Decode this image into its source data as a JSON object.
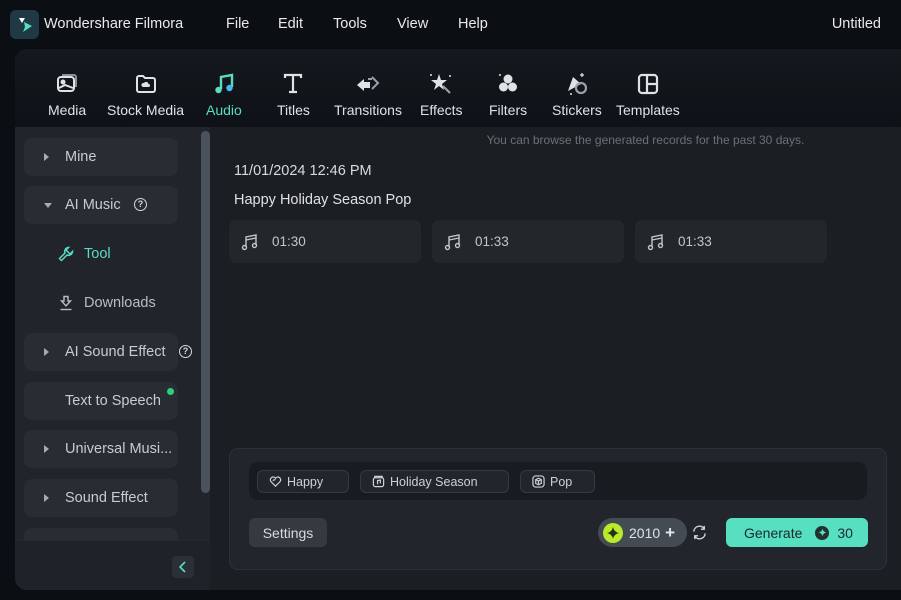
{
  "app": {
    "name": "Wondershare Filmora",
    "document_title": "Untitled",
    "menu": [
      "File",
      "Edit",
      "Tools",
      "View",
      "Help"
    ]
  },
  "toolbar": {
    "tabs": [
      {
        "label": "Media",
        "icon": "media-icon",
        "active": false
      },
      {
        "label": "Stock Media",
        "icon": "stock-media-icon",
        "active": false
      },
      {
        "label": "Audio",
        "icon": "music-note-icon",
        "active": true
      },
      {
        "label": "Titles",
        "icon": "text-t-icon",
        "active": false
      },
      {
        "label": "Transitions",
        "icon": "transitions-icon",
        "active": false
      },
      {
        "label": "Effects",
        "icon": "magic-wand-icon",
        "active": false
      },
      {
        "label": "Filters",
        "icon": "filters-icon",
        "active": false
      },
      {
        "label": "Stickers",
        "icon": "stickers-icon",
        "active": false
      },
      {
        "label": "Templates",
        "icon": "templates-icon",
        "active": false
      }
    ],
    "accent_color": "#59dcc1"
  },
  "sidebar": {
    "items": [
      {
        "label": "Mine",
        "expanded": false
      },
      {
        "label": "AI Music",
        "expanded": true,
        "help": true
      },
      {
        "label": "AI Sound Effect",
        "expanded": false,
        "help": true
      },
      {
        "label": "Text to Speech",
        "new_dot": true
      },
      {
        "label": "Universal Musi...",
        "expanded": false
      },
      {
        "label": "Sound Effect",
        "expanded": false
      }
    ],
    "sub_items": [
      {
        "label": "Tool",
        "icon": "wrench-icon",
        "active": true
      },
      {
        "label": "Downloads",
        "icon": "download-icon",
        "active": false
      }
    ]
  },
  "content": {
    "hint": "You can browse the generated records for the past 30 days.",
    "record": {
      "datetime": "11/01/2024 12:46 PM",
      "title": "Happy Holiday Season Pop",
      "tracks": [
        {
          "duration": "01:30"
        },
        {
          "duration": "01:33"
        },
        {
          "duration": "01:33"
        }
      ]
    }
  },
  "generator": {
    "tags": [
      {
        "label": "Happy",
        "icon": "heart-icon"
      },
      {
        "label": "Holiday Season",
        "icon": "music-box-icon"
      },
      {
        "label": "Pop",
        "icon": "cube-icon"
      }
    ],
    "settings_label": "Settings",
    "credits": "2010",
    "generate_label": "Generate",
    "generate_cost": "30",
    "generate_color": "#56dfc0",
    "credit_coin_color": "#b8ec2a"
  }
}
